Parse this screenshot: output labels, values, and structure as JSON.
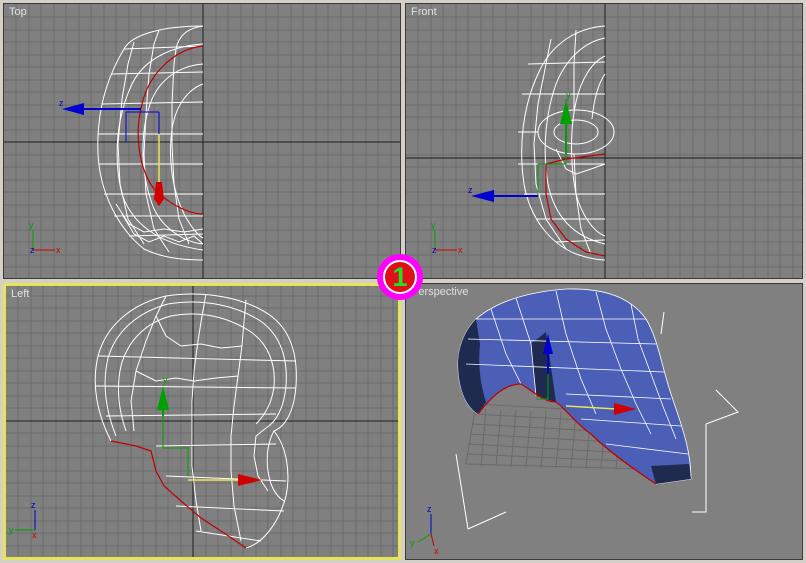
{
  "viewports": {
    "top": {
      "label": "Top",
      "active": false
    },
    "front": {
      "label": "Front",
      "active": false
    },
    "left": {
      "label": "Left",
      "active": true
    },
    "perspective": {
      "label": "Perspective",
      "active": false
    }
  },
  "axis_letters": {
    "x": "x",
    "y": "y",
    "z": "z"
  },
  "badge": {
    "number": "1"
  },
  "colors": {
    "viewport_bg": "#808080",
    "grid": "#6c6c6c",
    "grid_main": "#1e1e1e",
    "wire": "#ffffff",
    "open_edge": "#c00000",
    "active_border": "#e8e458",
    "mesh_fill": "#4a5fb5",
    "gizmo_x": "#d00000",
    "gizmo_y": "#00a000",
    "gizmo_z": "#0000d0",
    "badge_ring": "#ff00ff",
    "badge_fill": "#e0101a",
    "badge_digit": "#22e022"
  }
}
